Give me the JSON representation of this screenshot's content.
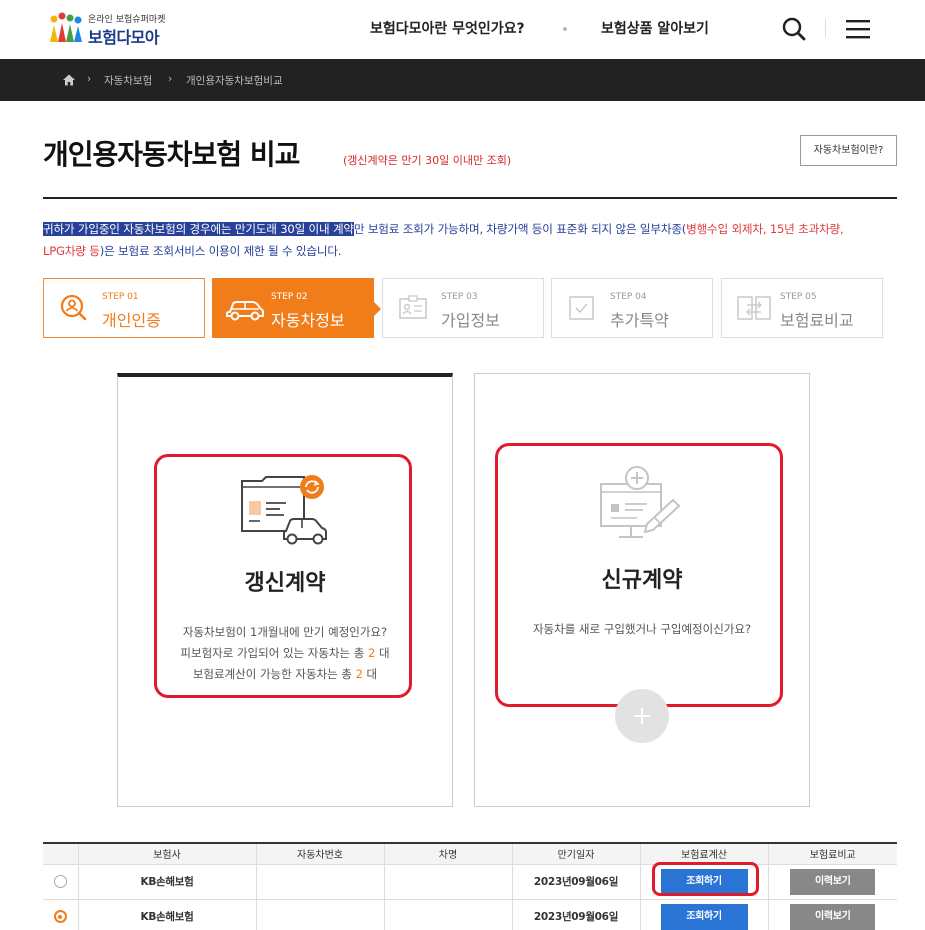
{
  "header": {
    "logo_sub": "온라인 보험슈퍼마켓",
    "logo_main": "보험다모아",
    "nav": [
      "보험다모아란 무엇인가요?",
      "보험상품 알아보기"
    ],
    "icons": [
      "search-icon",
      "menu-icon"
    ]
  },
  "breadcrumb": [
    "자동차보험",
    "개인용자동차보험비교"
  ],
  "page": {
    "title": "개인용자동차보험 비교",
    "title_note": "(갱신계약은 만기 30일 이내만 조회)",
    "help_button": "자동차보험이란?"
  },
  "notice": {
    "highlight": "귀하가 가입중인 자동차보험의 경우에는 만기도래 30일 이내 계약",
    "text1": "만 보험료 조회가 가능하며, 차량가액 등이 표준화 되지 않은 일부차종(",
    "red1": "병행수입 외제차, 15년 초과차량,",
    "red2": "LPG차량 등",
    "text2": ")은 보험료 조회서비스 이용이 제한 될 수 있습니다."
  },
  "steps": [
    {
      "num": "STEP 01",
      "label": "개인인증",
      "state": "done"
    },
    {
      "num": "STEP 02",
      "label": "자동차정보",
      "state": "active"
    },
    {
      "num": "STEP 03",
      "label": "가입정보",
      "state": "pending"
    },
    {
      "num": "STEP 04",
      "label": "추가특약",
      "state": "pending"
    },
    {
      "num": "STEP 05",
      "label": "보험료비교",
      "state": "pending"
    }
  ],
  "cards": {
    "renewal": {
      "title": "갱신계약",
      "line1": "자동차보험이 1개월내에 만기 예정인가요?",
      "line2_a": "피보험자로 가입되어 있는 자동차는 총 ",
      "line2_n": "2",
      "line2_b": " 대",
      "line3_a": "보험료계산이 가능한 자동차는 총 ",
      "line3_n": "2",
      "line3_b": " 대"
    },
    "new": {
      "title": "신규계약",
      "desc": "자동차를 새로 구입했거나 구입예정이신가요?"
    }
  },
  "table": {
    "headers": [
      "",
      "보험사",
      "자동차번호",
      "차명",
      "만기일자",
      "보험료계산",
      "보험료비교"
    ],
    "rows": [
      {
        "selected": false,
        "insurer": "KB손해보험",
        "car_no": "",
        "car_name": "",
        "expiry": "2023년09월06일",
        "calc": "조회하기",
        "compare": "이력보기"
      },
      {
        "selected": true,
        "insurer": "KB손해보험",
        "car_no": "",
        "car_name": "",
        "expiry": "2023년09월06일",
        "calc": "조회하기",
        "compare": "이력보기"
      }
    ]
  },
  "colors": {
    "accent": "#f07d1a",
    "highlight_box": "#e01b2b",
    "primary_button": "#2a74d6",
    "notice": "#27409a"
  }
}
